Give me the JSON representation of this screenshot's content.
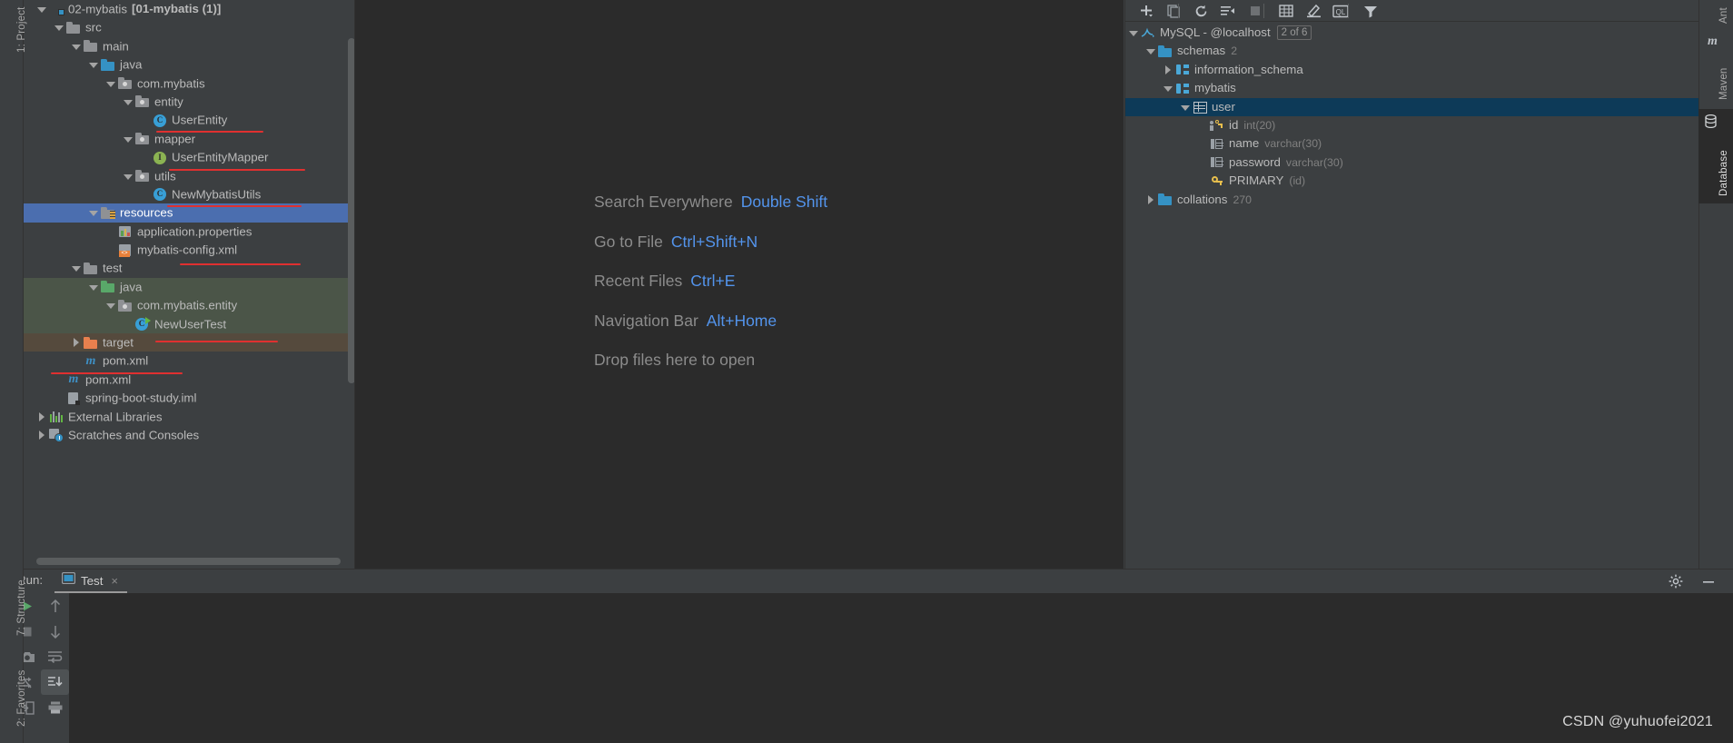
{
  "window": {
    "left_tool_labels": [
      "1: Project",
      "7: Structure",
      "2: Favorites"
    ],
    "right_tool_labels": [
      "Ant",
      "Maven",
      "Database"
    ],
    "right_active_tool": "Database"
  },
  "project_tree": {
    "title": "Project",
    "items": [
      {
        "label": "02-mybatis",
        "suffix": "[01-mybatis (1)]",
        "indent": 0,
        "arrow": "down",
        "icon": "module-folder-icon",
        "state": "normal"
      },
      {
        "label": "src",
        "indent": 1,
        "arrow": "down",
        "icon": "folder-icon",
        "state": "normal"
      },
      {
        "label": "main",
        "indent": 2,
        "arrow": "down",
        "icon": "folder-icon",
        "state": "normal"
      },
      {
        "label": "java",
        "indent": 3,
        "arrow": "down",
        "icon": "source-folder-icon",
        "state": "normal"
      },
      {
        "label": "com.mybatis",
        "indent": 4,
        "arrow": "down",
        "icon": "package-icon",
        "state": "normal"
      },
      {
        "label": "entity",
        "indent": 5,
        "arrow": "down",
        "icon": "package-icon",
        "state": "normal"
      },
      {
        "label": "UserEntity",
        "indent": 6,
        "arrow": "none",
        "icon": "java-class-icon",
        "state": "normal",
        "underlined": true
      },
      {
        "label": "mapper",
        "indent": 5,
        "arrow": "down",
        "icon": "package-icon",
        "state": "normal"
      },
      {
        "label": "UserEntityMapper",
        "indent": 6,
        "arrow": "none",
        "icon": "java-interface-icon",
        "state": "normal",
        "underlined": true
      },
      {
        "label": "utils",
        "indent": 5,
        "arrow": "down",
        "icon": "package-icon",
        "state": "normal"
      },
      {
        "label": "NewMybatisUtils",
        "indent": 6,
        "arrow": "none",
        "icon": "java-class-icon",
        "state": "normal",
        "underlined": true
      },
      {
        "label": "resources",
        "indent": 3,
        "arrow": "down",
        "icon": "resources-folder-icon",
        "state": "selected"
      },
      {
        "label": "application.properties",
        "indent": 4,
        "arrow": "none",
        "icon": "properties-file-icon",
        "state": "normal"
      },
      {
        "label": "mybatis-config.xml",
        "indent": 4,
        "arrow": "none",
        "icon": "xml-file-icon",
        "state": "normal",
        "underlined": true
      },
      {
        "label": "test",
        "indent": 2,
        "arrow": "down",
        "icon": "folder-icon",
        "state": "normal"
      },
      {
        "label": "java",
        "indent": 3,
        "arrow": "down",
        "icon": "test-source-folder-icon",
        "state": "test"
      },
      {
        "label": "com.mybatis.entity",
        "indent": 4,
        "arrow": "down",
        "icon": "package-icon",
        "state": "test"
      },
      {
        "label": "NewUserTest",
        "indent": 5,
        "arrow": "none",
        "icon": "test-class-icon",
        "state": "test",
        "underlined": true
      },
      {
        "label": "target",
        "indent": 2,
        "arrow": "right",
        "icon": "excluded-folder-icon",
        "state": "target"
      },
      {
        "label": "pom.xml",
        "indent": 2,
        "arrow": "none",
        "icon": "maven-file-icon",
        "state": "normal",
        "underlined": true
      },
      {
        "label": "pom.xml",
        "indent": 1,
        "arrow": "none",
        "icon": "maven-file-icon",
        "state": "normal"
      },
      {
        "label": "spring-boot-study.iml",
        "indent": 1,
        "arrow": "none",
        "icon": "iml-file-icon",
        "state": "normal"
      },
      {
        "label": "External Libraries",
        "indent": 0,
        "arrow": "right",
        "icon": "external-libraries-icon",
        "state": "normal"
      },
      {
        "label": "Scratches and Consoles",
        "indent": 0,
        "arrow": "right",
        "icon": "scratches-icon",
        "state": "normal"
      }
    ]
  },
  "editor": {
    "shortcuts": [
      {
        "action": "Search Everywhere",
        "keys": "Double Shift"
      },
      {
        "action": "Go to File",
        "keys": "Ctrl+Shift+N"
      },
      {
        "action": "Recent Files",
        "keys": "Ctrl+E"
      },
      {
        "action": "Navigation Bar",
        "keys": "Alt+Home"
      },
      {
        "action": "Drop files here to open",
        "keys": ""
      }
    ],
    "key_color": "#5394ec",
    "action_color": "#8c8c8c"
  },
  "database": {
    "toolbar_buttons": [
      "add-icon",
      "copy-icon",
      "refresh-icon",
      "sync-settings-icon",
      "stop-icon",
      "table-view-icon",
      "edit-icon",
      "query-console-icon",
      "filter-icon"
    ],
    "tree": [
      {
        "label": "MySQL - @localhost",
        "badge": "2 of 6",
        "indent": 0,
        "arrow": "down",
        "icon": "mysql-icon",
        "state": "normal"
      },
      {
        "label": "schemas",
        "sub": "2",
        "indent": 1,
        "arrow": "down",
        "icon": "db-folder-icon",
        "state": "normal"
      },
      {
        "label": "information_schema",
        "indent": 2,
        "arrow": "right",
        "icon": "schema-icon",
        "state": "normal"
      },
      {
        "label": "mybatis",
        "indent": 2,
        "arrow": "down",
        "icon": "schema-icon",
        "state": "normal"
      },
      {
        "label": "user",
        "indent": 3,
        "arrow": "down",
        "icon": "table-icon",
        "state": "selected"
      },
      {
        "label": "id",
        "sub": "int(20)",
        "indent": 4,
        "arrow": "none",
        "icon": "primary-key-column-icon",
        "state": "normal"
      },
      {
        "label": "name",
        "sub": "varchar(30)",
        "indent": 4,
        "arrow": "none",
        "icon": "column-icon",
        "state": "normal"
      },
      {
        "label": "password",
        "sub": "varchar(30)",
        "indent": 4,
        "arrow": "none",
        "icon": "column-icon",
        "state": "normal"
      },
      {
        "label": "PRIMARY",
        "sub": "(id)",
        "indent": 4,
        "arrow": "none",
        "icon": "key-icon",
        "state": "normal"
      },
      {
        "label": "collations",
        "sub": "270",
        "indent": 1,
        "arrow": "right",
        "icon": "db-folder-icon",
        "state": "normal"
      }
    ]
  },
  "run_panel": {
    "title": "Run:",
    "tab_label": "Test",
    "tab_close": "×",
    "toolbar_left": [
      "run-icon",
      "stop-icon",
      "camera-icon",
      "rerun-failed-icon",
      "export-icon"
    ],
    "toolbar_right": [
      "move-up-icon",
      "move-down-icon",
      "soft-wrap-icon",
      "scroll-to-end-icon",
      "print-icon"
    ],
    "settings_icon": "gear-icon",
    "minimize_icon": "minimize-icon"
  },
  "watermark": {
    "text": "CSDN @yuhuofei2021"
  },
  "colors": {
    "panel_bg": "#3c3f41",
    "editor_bg": "#2b2b2b",
    "selection_blue": "#4b6eaf",
    "db_selection": "#0d3a58",
    "test_source_bg": "#4b5548",
    "target_bg": "#554a3d",
    "annotation_red": "#e03030",
    "link_blue": "#5394ec",
    "text": "#bbbbbb"
  }
}
